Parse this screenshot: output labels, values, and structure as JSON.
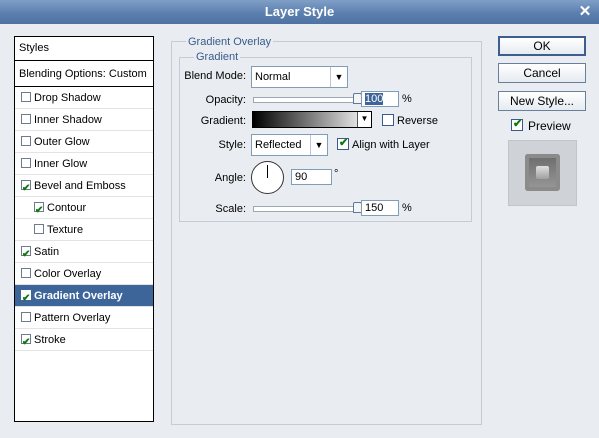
{
  "window": {
    "title": "Layer Style",
    "close_glyph": "✕"
  },
  "styles_list": {
    "header": "Styles",
    "blending": "Blending Options: Custom",
    "items": [
      {
        "label": "Drop Shadow",
        "checked": false
      },
      {
        "label": "Inner Shadow",
        "checked": false
      },
      {
        "label": "Outer Glow",
        "checked": false
      },
      {
        "label": "Inner Glow",
        "checked": false
      },
      {
        "label": "Bevel and Emboss",
        "checked": true
      },
      {
        "label": "Contour",
        "checked": true
      },
      {
        "label": "Texture",
        "checked": false
      },
      {
        "label": "Satin",
        "checked": true
      },
      {
        "label": "Color Overlay",
        "checked": false
      },
      {
        "label": "Gradient Overlay",
        "checked": true,
        "selected": true
      },
      {
        "label": "Pattern Overlay",
        "checked": false
      },
      {
        "label": "Stroke",
        "checked": true
      }
    ]
  },
  "panel": {
    "section_title": "Gradient Overlay",
    "subsection_title": "Gradient",
    "blend_mode": {
      "label": "Blend Mode:",
      "value": "Normal"
    },
    "opacity": {
      "label": "Opacity:",
      "value": "100",
      "unit": "%",
      "fraction": 1.0
    },
    "gradient": {
      "label": "Gradient:",
      "reverse_label": "Reverse",
      "reverse": false
    },
    "style": {
      "label": "Style:",
      "value": "Reflected",
      "align_label": "Align with Layer",
      "align": true
    },
    "angle": {
      "label": "Angle:",
      "value": "90",
      "unit": "°"
    },
    "scale": {
      "label": "Scale:",
      "value": "150",
      "unit": "%",
      "fraction": 1.0
    }
  },
  "buttons": {
    "ok": "OK",
    "cancel": "Cancel",
    "new_style": "New Style..."
  },
  "preview": {
    "label": "Preview",
    "checked": true
  }
}
